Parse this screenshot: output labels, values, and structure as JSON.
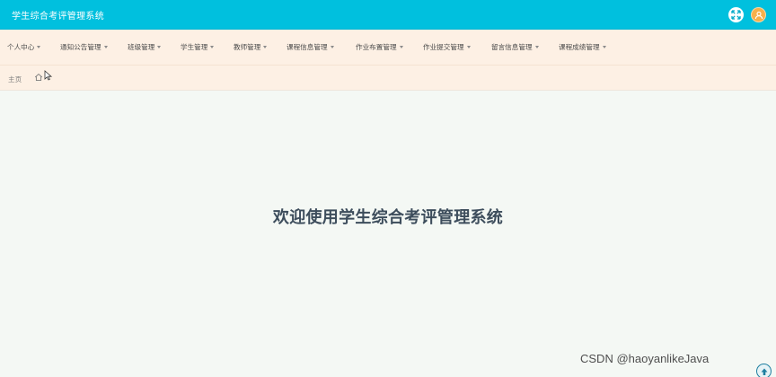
{
  "header": {
    "app_title": "学生综合考评管理系统",
    "icons": {
      "fullscreen": "fullscreen-icon",
      "user": "user-avatar-icon"
    },
    "colors": {
      "bar": "#00c0de",
      "user_button": "#f6b04a"
    }
  },
  "nav": {
    "items": [
      {
        "label": "个人中心"
      },
      {
        "label": "通知公告管理"
      },
      {
        "label": "班级管理"
      },
      {
        "label": "学生管理"
      },
      {
        "label": "教师管理"
      },
      {
        "label": "课程信息管理"
      },
      {
        "label": "作业布置管理"
      },
      {
        "label": "作业提交管理"
      },
      {
        "label": "留言信息管理"
      },
      {
        "label": "课程成绩管理"
      }
    ]
  },
  "breadcrumb": {
    "home_label": "主页",
    "icon": "home-icon"
  },
  "main": {
    "welcome_text": "欢迎使用学生综合考评管理系统"
  },
  "watermark": {
    "text": "CSDN @haoyanlikeJava"
  },
  "scroll_top": {
    "icon": "arrow-up-icon"
  }
}
